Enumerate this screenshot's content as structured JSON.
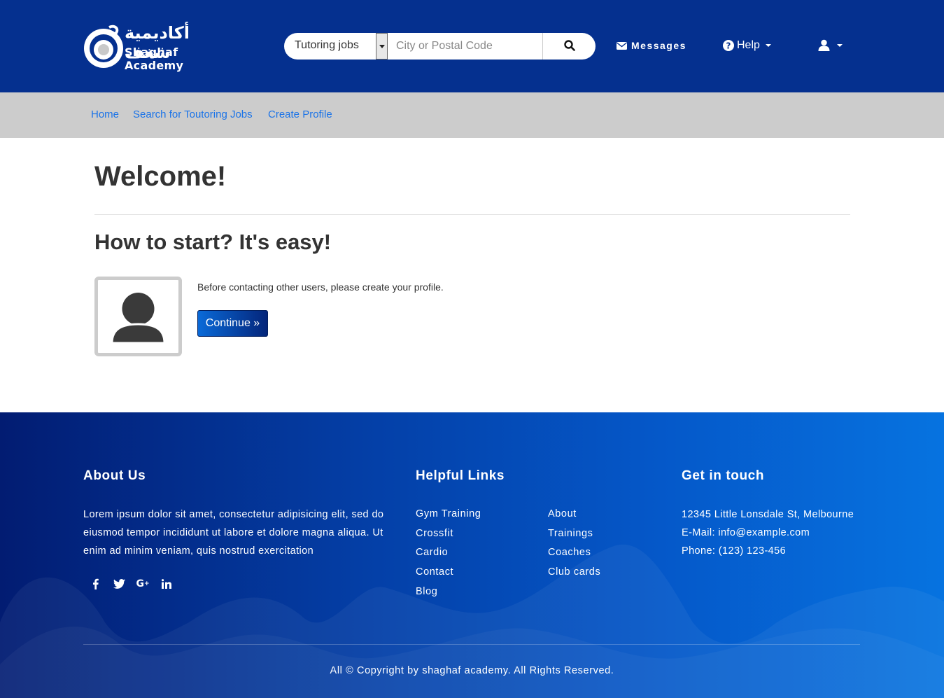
{
  "header": {
    "logo": {
      "arabic": "أكاديمية شغف",
      "english": "Shaghaf Academy"
    },
    "search": {
      "category_selected": "Tutoring jobs",
      "location_placeholder": "City or Postal Code",
      "search_icon": "search-icon"
    },
    "messages_label": "Messages",
    "help_label": "Help",
    "user_icon": "user-icon"
  },
  "subnav": {
    "items": [
      {
        "label": "Home"
      },
      {
        "label": "Search for Toutoring Jobs"
      },
      {
        "label": "Create Profile"
      }
    ]
  },
  "main": {
    "title": "Welcome!",
    "subtitle": "How to start? It's easy!",
    "intro_text": "Before contacting other users, please create your profile.",
    "continue_label": "Continue »",
    "avatar_icon": "user-placeholder-icon"
  },
  "footer": {
    "about": {
      "heading": "About Us",
      "text": "Lorem ipsum dolor sit amet, consectetur adipisicing elit, sed do eiusmod tempor incididunt ut labore et dolore magna aliqua. Ut enim ad minim veniam, quis nostrud exercitation",
      "social": [
        "facebook-icon",
        "twitter-icon",
        "google-plus-icon",
        "linkedin-icon"
      ]
    },
    "links": {
      "heading": "Helpful Links",
      "col1": [
        "Gym Training",
        "Crossfit",
        "Cardio",
        "Contact",
        "Blog"
      ],
      "col2": [
        "About",
        "Trainings",
        "Coaches",
        "Club cards"
      ]
    },
    "contact": {
      "heading": "Get in touch",
      "address": "12345 Little Lonsdale St, Melbourne",
      "email": "E-Mail: info@example.com",
      "phone": "Phone: (123) 123-456"
    },
    "copyright": "All © Copyright by shaghaf academy. All Rights Reserved."
  },
  "colors": {
    "header_bg": "#05308f",
    "subnav_bg": "#cccccc",
    "link": "#1a73e8",
    "button_start": "#0a6ad8",
    "button_end": "#04257a"
  }
}
